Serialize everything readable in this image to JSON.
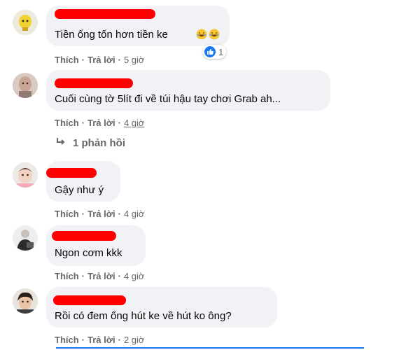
{
  "comments": [
    {
      "text": "Tiền ống tốn hơn tiền ke",
      "actions": {
        "like": "Thích",
        "reply": "Trả lời",
        "time": "5 giờ"
      },
      "reaction_count": "1",
      "reaction": "like-icon"
    },
    {
      "text": "Cuối cùng tờ 5lít đi về túi hậu tay chơi Grab ah...",
      "actions": {
        "like": "Thích",
        "reply": "Trả lời",
        "time": "4 giờ"
      },
      "replies_label": "1 phản hồi"
    },
    {
      "text": "Gậy như ý",
      "actions": {
        "like": "Thích",
        "reply": "Trả lời",
        "time": "4 giờ"
      }
    },
    {
      "text": "Ngon cơm kkk",
      "actions": {
        "like": "Thích",
        "reply": "Trả lời",
        "time": "4 giờ"
      }
    },
    {
      "text": "Rồi có đem ống hút ke về hút ko ông?",
      "actions": {
        "like": "Thích",
        "reply": "Trả lời",
        "time": "2 giờ"
      }
    }
  ],
  "separator": "·",
  "colors": {
    "bubble": "#f0f2f5",
    "redaction": "#ff0000",
    "meta": "#65676b",
    "like": "#1877f2"
  }
}
